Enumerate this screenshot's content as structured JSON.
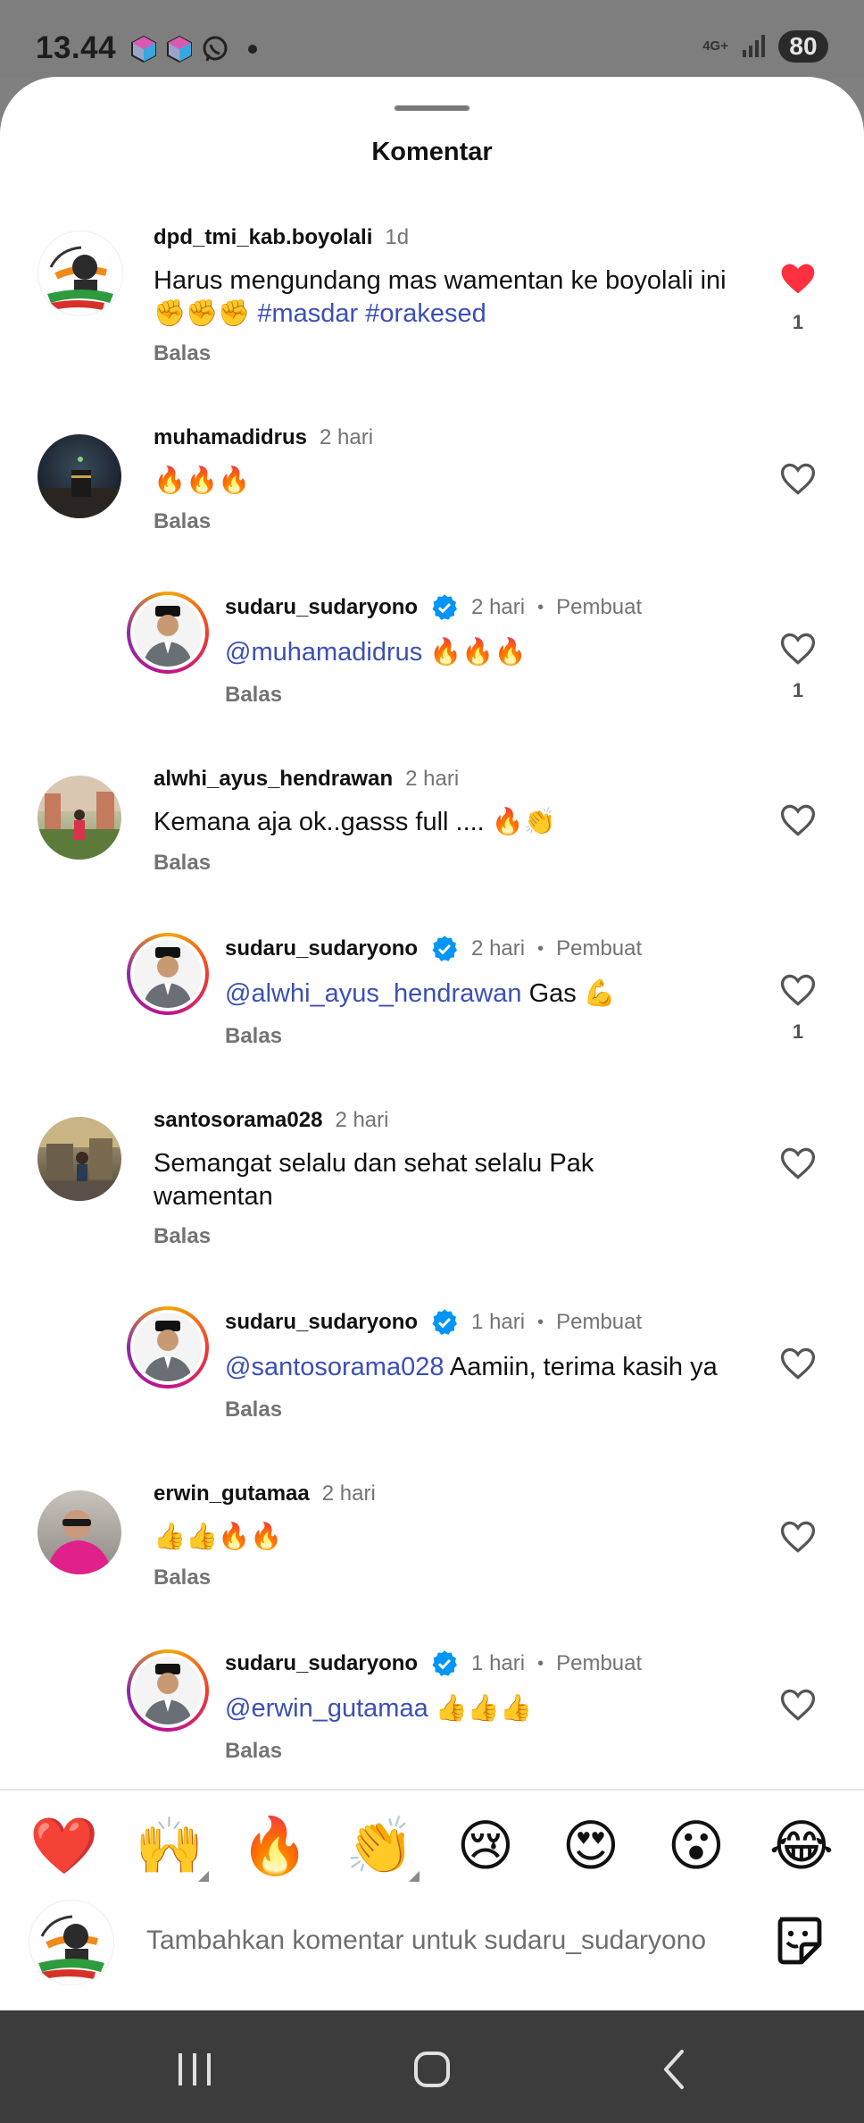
{
  "status_bar": {
    "time": "13.44",
    "network": "4G+",
    "battery": "80"
  },
  "sheet": {
    "title": "Komentar"
  },
  "comments": [
    {
      "user": "dpd_tmi_kab.boyolali",
      "time": "1d",
      "text": "Harus mengundang mas wamentan ke boyolali ini ✊✊✊",
      "tag1": "#masdar",
      "tag2": "#orakesed",
      "reply": "Balas",
      "likes": "1",
      "liked": true
    },
    {
      "user": "muhamadidrus",
      "time": "2 hari",
      "text": "🔥🔥🔥",
      "reply": "Balas"
    },
    {
      "user": "sudaru_sudaryono",
      "time": "2 hari",
      "creator": "Pembuat",
      "mention": "@muhamadidrus",
      "text": " 🔥🔥🔥",
      "reply": "Balas",
      "likes": "1"
    },
    {
      "user": "alwhi_ayus_hendrawan",
      "time": "2 hari",
      "text": "Kemana aja ok..gasss full .... 🔥👏",
      "reply": "Balas"
    },
    {
      "user": "sudaru_sudaryono",
      "time": "2 hari",
      "creator": "Pembuat",
      "mention": "@alwhi_ayus_hendrawan",
      "text": " Gas 💪",
      "reply": "Balas",
      "likes": "1"
    },
    {
      "user": "santosorama028",
      "time": "2 hari",
      "text_line1": "Semangat selalu dan sehat selalu Pak",
      "text_line2": "wamentan",
      "reply": "Balas"
    },
    {
      "user": "sudaru_sudaryono",
      "time": "1 hari",
      "creator": "Pembuat",
      "mention": "@santosorama028",
      "text": " Aamiin, terima kasih ya",
      "reply": "Balas"
    },
    {
      "user": "erwin_gutamaa",
      "time": "2 hari",
      "text": "👍👍🔥🔥",
      "reply": "Balas"
    },
    {
      "user": "sudaru_sudaryono",
      "time": "1 hari",
      "creator": "Pembuat",
      "mention": "@erwin_gutamaa",
      "text": " 👍👍👍",
      "reply": "Balas"
    }
  ],
  "emoji_bar": [
    "❤️",
    "🙌",
    "🔥",
    "👏",
    "😢",
    "😍",
    "😮",
    "😂"
  ],
  "input": {
    "placeholder": "Tambahkan komentar untuk sudaru_sudaryono"
  },
  "icons": {
    "heart": "heart-icon",
    "verified": "verified-badge-icon",
    "sticker": "sticker-icon",
    "nav_recent": "recent-apps-icon",
    "nav_home": "home-icon",
    "nav_back": "back-icon"
  },
  "colors": {
    "accent_link": "#3c4fb5",
    "like_red": "#ff3040",
    "verified_blue": "#0095f6"
  }
}
